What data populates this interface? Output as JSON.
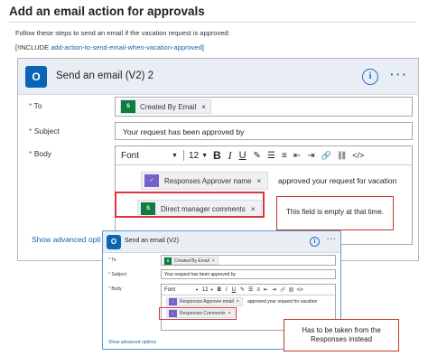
{
  "doc": {
    "title": "Add an email action for approvals",
    "instructions": "Follow these steps to send an email if the vacation request is approved:",
    "include_prefix": "[!INCLUDE ",
    "include_link": "add-action-to-send-email-when-vacation-approved",
    "include_suffix": "]"
  },
  "main_card": {
    "icon_text": "O",
    "title": "Send an email (V2) 2",
    "to_label": "To",
    "to_chip": "Created By Email",
    "subject_label": "Subject",
    "subject_value": "Your request has been approved by",
    "body_label": "Body",
    "font_name": "Font",
    "font_size": "12",
    "chip_approver": "Responses Approver name",
    "approved_text": "approved your request for vacation",
    "chip_manager": "Direct manager comments",
    "show_advanced": "Show advanced opti",
    "required_mark": "*",
    "chip_close": "×",
    "more": "···",
    "info": "i"
  },
  "callouts": {
    "empty_field": "This field is empty at that time.",
    "take_from_responses": "Has to be taken from the Responses instead"
  },
  "small_card": {
    "icon_text": "O",
    "title": "Send an email (V2)",
    "to_label": "To",
    "to_chip": "Created By Email",
    "subject_label": "Subject",
    "subject_value": "Your request has been approved by",
    "body_label": "Body",
    "font_name": "Font",
    "font_size": "12",
    "chip_approver": "Responses Approver email",
    "approved_text": "approved your request for vacation",
    "chip_comments": "Responses Comments",
    "show_advanced": "Show advanced options",
    "required_mark": "*",
    "chip_close": "×",
    "more": "···",
    "info": "i"
  },
  "toolbar": {
    "dropdown_arrow": "▼",
    "bold": "B",
    "italic": "I",
    "underline": "U",
    "pen": "✎",
    "bullets": "☰",
    "numbering": "≡",
    "indent_dec": "⇤",
    "indent_inc": "⇥",
    "link": "🔗",
    "unlink": "⛓",
    "code": "</>"
  },
  "colors": {
    "accent": "#2e6fc2",
    "highlight": "#d9363e",
    "excel_green": "#107c41",
    "forms_purple": "#7461c9"
  }
}
